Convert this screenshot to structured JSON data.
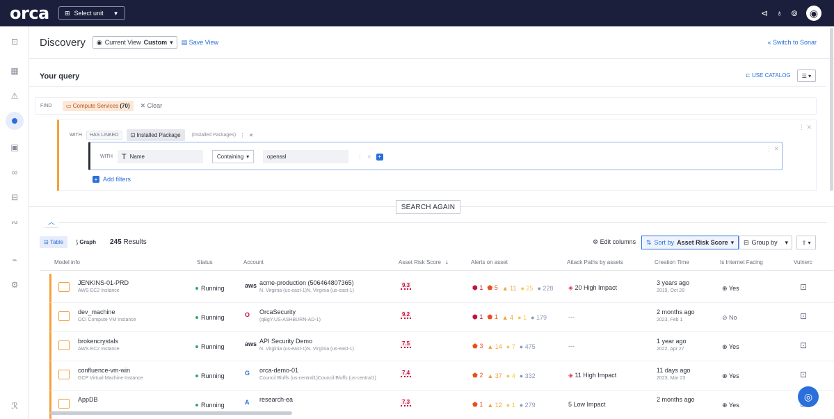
{
  "topbar": {
    "logo": "orca",
    "unit_select": "Select unit"
  },
  "header": {
    "title": "Discovery",
    "view_prefix": "Current View",
    "view_value": "Custom",
    "save_view": "Save View",
    "switch_sonar": "Switch to Sonar"
  },
  "query": {
    "title": "Your query",
    "use_catalog": "USE CATALOG",
    "find_label": "FIND",
    "compute_prefix": "Compute Services",
    "compute_count": "(70)",
    "clear": "Clear",
    "with_label": "WITH",
    "has_linked": "HAS LINKED",
    "installed_package": "Installed Package",
    "installed_packages_label": "(Installed Packages)",
    "inner_with": "WITH",
    "field_name": "Name",
    "operator": "Containing",
    "value": "openssl",
    "add_filters": "Add filters",
    "search_again": "SEARCH AGAIN"
  },
  "toolbar": {
    "tab_table": "Table",
    "tab_graph": "Graph",
    "results_count": "245",
    "results_label": "Results",
    "edit_columns": "Edit columns",
    "sort_prefix": "Sort by",
    "sort_value": "Asset Risk Score",
    "group_by": "Group by"
  },
  "columns": [
    "Model info",
    "Status",
    "Account",
    "Asset Risk Score",
    "Alerts on asset",
    "Attack Paths by assets",
    "Creation Time",
    "Is Internet Facing",
    "Vulnerc"
  ],
  "rows": [
    {
      "name": "JENKINS-01-PRD",
      "type": "AWS EC2 Instance",
      "status": "Running",
      "acct_logo": "aws",
      "acct": "acme-production (506464807365)",
      "acct_sub": "N. Virginia (us-east-1)N. Virginia (us-east-1)",
      "risk": "9.3",
      "a1": "1",
      "a2": "5",
      "a3": "11",
      "a4": "25",
      "a5": "228",
      "attack": "20 High Impact",
      "created": "3 years ago",
      "created_sub": "2019, Oct 28",
      "internet": "Yes"
    },
    {
      "name": "dev_machine",
      "type": "OCI Compute VM Instance",
      "status": "Running",
      "acct_logo": "O",
      "acct": "OrcaSecurity",
      "acct_sub": "(qBgY:US-ASHBURN-AD-1)",
      "risk": "9.2",
      "a1": "1",
      "a2": "1",
      "a3": "4",
      "a4": "1",
      "a5": "179",
      "attack": "---",
      "created": "2 months ago",
      "created_sub": "2023, Feb 1",
      "internet": "No"
    },
    {
      "name": "brokencrystals",
      "type": "AWS EC2 Instance",
      "status": "Running",
      "acct_logo": "aws",
      "acct": "API Security Demo",
      "acct_sub": "N. Virginia (us-east-1)N. Virginia (us-east-1)",
      "risk": "7.5",
      "a1": "",
      "a2": "3",
      "a3": "14",
      "a4": "7",
      "a5": "475",
      "attack": "---",
      "created": "1 year ago",
      "created_sub": "2022, Apr 27",
      "internet": "Yes"
    },
    {
      "name": "confluence-vm-win",
      "type": "GCP Virtual Machine Instance",
      "status": "Running",
      "acct_logo": "G",
      "acct": "orca-demo-01",
      "acct_sub": "Council Bluffs (us-central1)Council Bluffs (us-central1)",
      "risk": "7.4",
      "a1": "",
      "a2": "2",
      "a3": "37",
      "a4": "4",
      "a5": "332",
      "attack": "11 High Impact",
      "created": "11 days ago",
      "created_sub": "2023, Mar 23",
      "internet": "Yes"
    },
    {
      "name": "AppDB",
      "type": "",
      "status": "Running",
      "acct_logo": "A",
      "acct": "research-ea",
      "acct_sub": "",
      "risk": "7.3",
      "a1": "",
      "a2": "1",
      "a3": "12",
      "a4": "1",
      "a5": "279",
      "attack": "5 Low Impact",
      "created": "2 months ago",
      "created_sub": "",
      "internet": "Yes"
    }
  ]
}
